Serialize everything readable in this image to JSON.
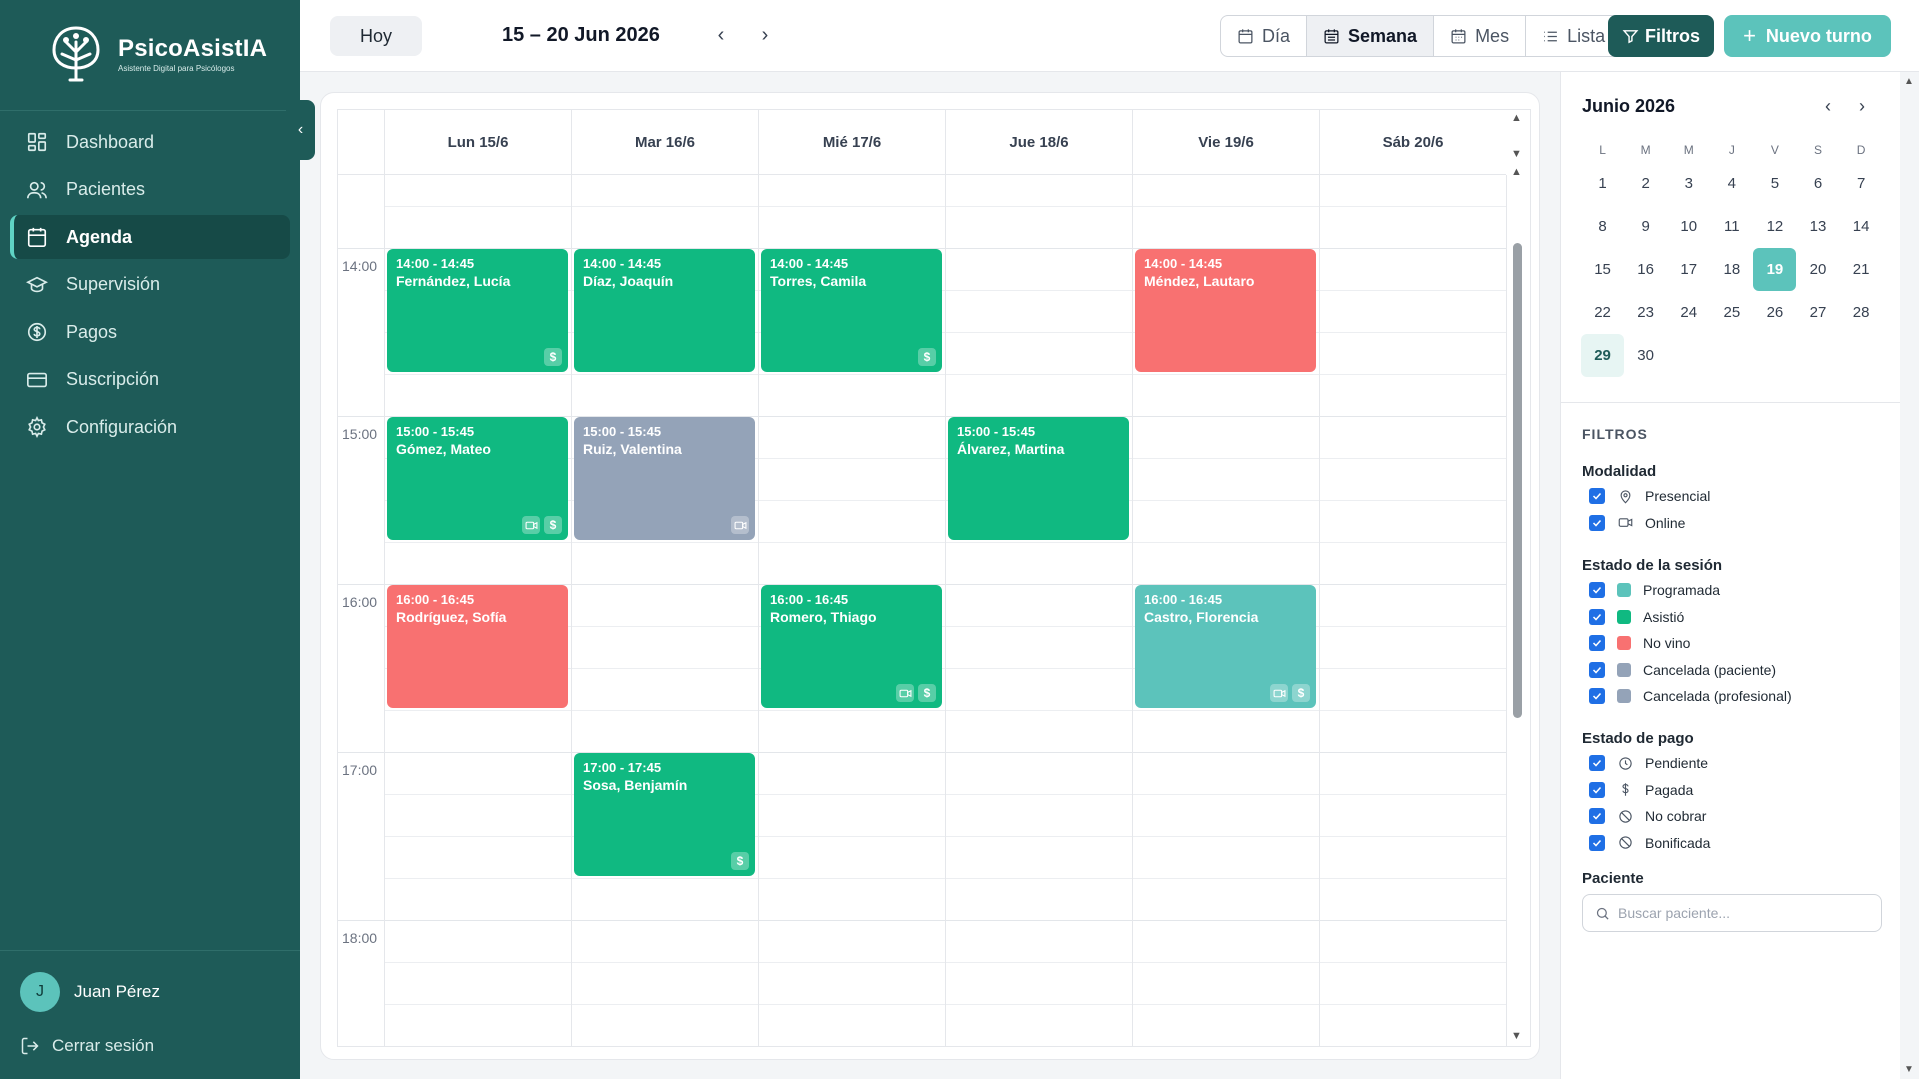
{
  "brand": {
    "name": "PsicoAsistIA",
    "tagline": "Asistente Digital para Psicólogos"
  },
  "sidebar": {
    "items": [
      {
        "label": "Dashboard",
        "icon": "dashboard-icon"
      },
      {
        "label": "Pacientes",
        "icon": "users-icon"
      },
      {
        "label": "Agenda",
        "icon": "calendar-icon",
        "active": true
      },
      {
        "label": "Supervisión",
        "icon": "graduation-cap-icon"
      },
      {
        "label": "Pagos",
        "icon": "dollar-circle-icon"
      },
      {
        "label": "Suscripción",
        "icon": "credit-card-icon"
      },
      {
        "label": "Configuración",
        "icon": "gear-icon"
      }
    ],
    "user": {
      "initial": "J",
      "name": "Juan Pérez"
    },
    "logout_label": "Cerrar sesión"
  },
  "toolbar": {
    "today_label": "Hoy",
    "date_range": "15 – 20 Jun 2026",
    "views": [
      "Día",
      "Semana",
      "Mes",
      "Lista"
    ],
    "active_view": "Semana",
    "filters_label": "Filtros",
    "new_label": "Nuevo turno"
  },
  "calendar": {
    "days": [
      "Lun 15/6",
      "Mar 16/6",
      "Mié 17/6",
      "Jue 18/6",
      "Vie 19/6",
      "Sáb 20/6"
    ],
    "hours": [
      "14:00",
      "15:00",
      "16:00",
      "17:00",
      "18:00"
    ],
    "colors": {
      "asistio": "#10b981",
      "no_vino": "#f87171",
      "cancelada": "#94a3b8",
      "programada": "#5cc3bb"
    },
    "events": [
      {
        "day": 0,
        "start": "14:00",
        "time": "14:00 - 14:45",
        "name": "Fernández, Lucía",
        "status": "asistio",
        "icons": [
          "$"
        ]
      },
      {
        "day": 1,
        "start": "14:00",
        "time": "14:00 - 14:45",
        "name": "Díaz, Joaquín",
        "status": "asistio",
        "icons": []
      },
      {
        "day": 2,
        "start": "14:00",
        "time": "14:00 - 14:45",
        "name": "Torres, Camila",
        "status": "asistio",
        "icons": [
          "$"
        ]
      },
      {
        "day": 4,
        "start": "14:00",
        "time": "14:00 - 14:45",
        "name": "Méndez, Lautaro",
        "status": "no_vino",
        "icons": []
      },
      {
        "day": 0,
        "start": "15:00",
        "time": "15:00 - 15:45",
        "name": "Gómez, Mateo",
        "status": "asistio",
        "icons": [
          "video",
          "$"
        ]
      },
      {
        "day": 1,
        "start": "15:00",
        "time": "15:00 - 15:45",
        "name": "Ruiz, Valentina",
        "status": "cancelada",
        "icons": [
          "video"
        ]
      },
      {
        "day": 3,
        "start": "15:00",
        "time": "15:00 - 15:45",
        "name": "Álvarez, Martina",
        "status": "asistio",
        "icons": []
      },
      {
        "day": 0,
        "start": "16:00",
        "time": "16:00 - 16:45",
        "name": "Rodríguez, Sofía",
        "status": "no_vino",
        "icons": []
      },
      {
        "day": 2,
        "start": "16:00",
        "time": "16:00 - 16:45",
        "name": "Romero, Thiago",
        "status": "asistio",
        "icons": [
          "video",
          "$"
        ]
      },
      {
        "day": 4,
        "start": "16:00",
        "time": "16:00 - 16:45",
        "name": "Castro, Florencia",
        "status": "programada",
        "icons": [
          "video",
          "$"
        ]
      },
      {
        "day": 1,
        "start": "17:00",
        "time": "17:00 - 17:45",
        "name": "Sosa, Benjamín",
        "status": "asistio",
        "icons": [
          "$"
        ]
      }
    ]
  },
  "mini_calendar": {
    "title": "Junio 2026",
    "weekdays": [
      "L",
      "M",
      "M",
      "J",
      "V",
      "S",
      "D"
    ],
    "weeks": [
      [
        "1",
        "2",
        "3",
        "4",
        "5",
        "6",
        "7"
      ],
      [
        "8",
        "9",
        "10",
        "11",
        "12",
        "13",
        "14"
      ],
      [
        "15",
        "16",
        "17",
        "18",
        "19",
        "20",
        "21"
      ],
      [
        "22",
        "23",
        "24",
        "25",
        "26",
        "27",
        "28"
      ],
      [
        "29",
        "30",
        "",
        "",
        "",
        "",
        ""
      ]
    ],
    "selected": "19",
    "today": "29"
  },
  "filters": {
    "title": "FILTROS",
    "groups": [
      {
        "title": "Modalidad",
        "items": [
          {
            "label": "Presencial",
            "icon": "map-pin-icon"
          },
          {
            "label": "Online",
            "icon": "video-icon"
          }
        ]
      },
      {
        "title": "Estado de la sesión",
        "items": [
          {
            "label": "Programada",
            "color": "#5cc3bb"
          },
          {
            "label": "Asistió",
            "color": "#10b981"
          },
          {
            "label": "No vino",
            "color": "#f87171"
          },
          {
            "label": "Cancelada (paciente)",
            "color": "#94a3b8"
          },
          {
            "label": "Cancelada (profesional)",
            "color": "#94a3b8"
          }
        ]
      },
      {
        "title": "Estado de pago",
        "items": [
          {
            "label": "Pendiente",
            "icon": "clock-icon"
          },
          {
            "label": "Pagada",
            "icon": "dollar-icon"
          },
          {
            "label": "No cobrar",
            "icon": "ban-icon"
          },
          {
            "label": "Bonificada",
            "icon": "ban-icon"
          }
        ]
      }
    ],
    "patient_label": "Paciente",
    "patient_placeholder": "Buscar paciente..."
  }
}
